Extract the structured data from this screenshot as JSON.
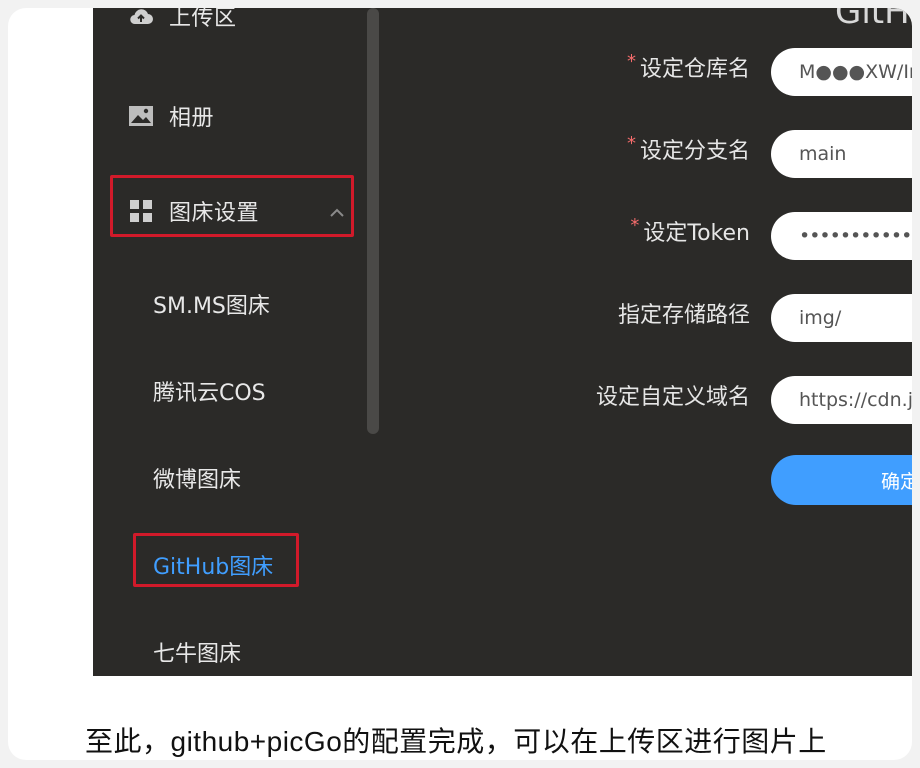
{
  "sidebar": {
    "upload_label": "上传区",
    "album_label": "相册",
    "picbed_settings_label": "图床设置",
    "sub_items": [
      {
        "label": "SM.MS图床"
      },
      {
        "label": "腾讯云COS"
      },
      {
        "label": "微博图床"
      },
      {
        "label": "GitHub图床"
      },
      {
        "label": "七牛图床"
      }
    ],
    "icons": {
      "upload": "cloud-upload-icon",
      "album": "image-icon",
      "settings": "grid-icon",
      "expand": "chevron-up-icon"
    }
  },
  "form": {
    "header_partial": "GitHu",
    "fields": [
      {
        "label": "设定仓库名",
        "required": "*",
        "value": "M●●●XW/Ima"
      },
      {
        "label": "设定分支名",
        "required": "*",
        "value": "main"
      },
      {
        "label": "设定Token",
        "required": "*",
        "value": "••••••••••••••••••"
      },
      {
        "label": "指定存储路径",
        "value": "img/"
      },
      {
        "label": "设定自定义域名",
        "value": "https://cdn.jsd"
      }
    ],
    "confirm_label": "确定"
  },
  "caption": "至此，github+picGo的配置完成，可以在上传区进行图片上",
  "colors": {
    "background": "#2b2a28",
    "accent": "#409eff",
    "highlight_box": "#d11a2a"
  }
}
